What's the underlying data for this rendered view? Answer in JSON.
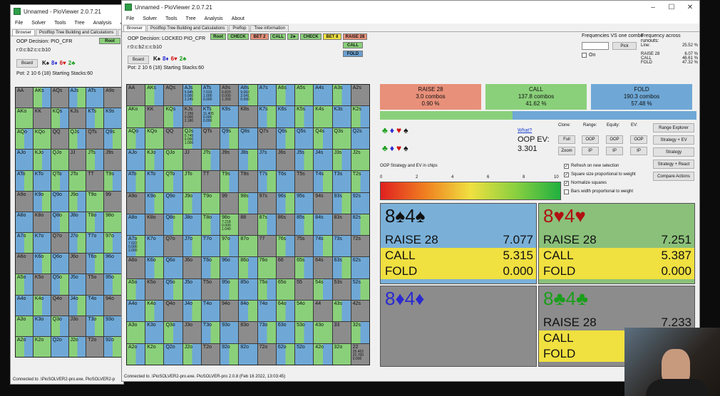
{
  "back_window": {
    "title": "Unnamed - PioViewer 2.0.7.21",
    "menu": [
      "File",
      "Solver",
      "Tools",
      "Tree",
      "Analysis",
      "Abo"
    ],
    "tabs": [
      "Browser",
      "Postflop Tree Building and Calculations",
      "Pre"
    ],
    "oop_decision": "OOP Decision:  PIO_CFR",
    "line": "r:0:c:b2:c:c:b10",
    "board_label": "Board",
    "board_cards": [
      {
        "t": "K♠",
        "c": "#111"
      },
      {
        "t": "8♦",
        "c": "#2a2ad0"
      },
      {
        "t": "6♥",
        "c": "#d01010"
      },
      {
        "t": "2♣",
        "c": "#1a9e1a"
      }
    ],
    "pot": "Pot: 2 10 6 (18) Starting Stacks:60",
    "root": "Root",
    "status": "Connected to .\\PioSOLVER2-pro.exe. PioSOLVER2-p"
  },
  "main_window": {
    "title": "Unnamed - PioViewer 2.0.7.21",
    "menu": [
      "File",
      "Solver",
      "Tools",
      "Tree",
      "Analysis",
      "About"
    ],
    "tabs": [
      "Browser",
      "Postflop Tree Building and Calculations",
      "Preflop",
      "Tree information"
    ],
    "oop_decision": "OOP Decision:  LOCKED PIO_CFR",
    "line": "r:0:c:b2:c:c:b10",
    "board_label": "Board",
    "board_cards": [
      {
        "t": "K♠",
        "c": "#111"
      },
      {
        "t": "8♦",
        "c": "#2a2ad0"
      },
      {
        "t": "6♥",
        "c": "#d01010"
      },
      {
        "t": "2♣",
        "c": "#1a9e1a"
      }
    ],
    "pot": "Pot: 2 10 6 (18) Starting Stacks:60",
    "sequence": [
      {
        "t": "Root",
        "bg": "#8ad07a"
      },
      {
        "t": "CHECK",
        "bg": "#8ad07a"
      },
      {
        "t": "BET 2",
        "bg": "#e8907a"
      },
      {
        "t": "CALL",
        "bg": "#8ad07a"
      },
      {
        "t": "2♣",
        "bg": "#8ad07a"
      },
      {
        "t": "CHECK",
        "bg": "#8ad07a"
      },
      {
        "t": "BET 8",
        "bg": "#f0e040"
      },
      {
        "t": "RAISE 28",
        "bg": "#e8907a"
      }
    ],
    "sub_actions": [
      {
        "t": "CALL",
        "bg": "#8ad07a"
      },
      {
        "t": "FOLD",
        "bg": "#6a9fd0"
      }
    ],
    "status": "Connected to .\\PioSOLVER2-pro.exe. PioSOLVER-pro 2.0.8 (Feb 16 2022, 13:03:45)",
    "freq_vs_combo": "Frequencies VS one combo",
    "pick": "Pick",
    "on_label": "On",
    "freq_runouts": "Frequency across runouts:",
    "freq_rows": [
      {
        "k": "Line:",
        "v": "25.52 %"
      },
      {
        "k": "RAISE 28",
        "v": "6.07 %"
      },
      {
        "k": "CALL",
        "v": "46.61 %"
      },
      {
        "k": "FOLD",
        "v": "47.32 %"
      }
    ],
    "summary": [
      {
        "name": "RAISE 28",
        "combos": "3.0 combos",
        "pct": "0.90 %",
        "bg": "#e8907a"
      },
      {
        "name": "CALL",
        "combos": "137.8 combos",
        "pct": "41.62 %",
        "bg": "#8ad07a"
      },
      {
        "name": "FOLD",
        "combos": "190.3 combos",
        "pct": "57.48 %",
        "bg": "#6fa8d6"
      }
    ],
    "summary_bar": {
      "green_frac": 0.42,
      "blue_frac": 0.58
    },
    "what_link": "What?",
    "oop_ev_label": "OOP EV:",
    "oop_ev_value": "3.301",
    "controls": {
      "clone": "Clone:",
      "range": "Range:",
      "equity": "Equity:",
      "ev": "EV:",
      "full": "Full",
      "zoom": "Zoom",
      "oop": "OOP",
      "ip": "IP",
      "range_explorer": "Range Explorer",
      "strategy_ev": "Strategy + EV",
      "strategy": "Strategy",
      "strategy_react": "Strategy + React",
      "compare_actions": "Compare Actions"
    },
    "checkboxes": [
      {
        "t": "Refresh on new selection",
        "checked": true
      },
      {
        "t": "Square size proportional to weight",
        "checked": true
      },
      {
        "t": "Normalize squares",
        "checked": true
      },
      {
        "t": "Bars width proportional to weight",
        "checked": false
      }
    ],
    "ev_scale_label": "OOP Strategy and EV in chips",
    "ev_ticks": [
      "0",
      "2",
      "4",
      "6",
      "8",
      "10"
    ],
    "cards": [
      {
        "title": "8♠4♠",
        "color": "#111",
        "rows": [
          {
            "a": "RAISE 28",
            "v": "7.077"
          },
          {
            "a": "CALL",
            "v": "5.315"
          },
          {
            "a": "FOLD",
            "v": "0.000"
          }
        ]
      },
      {
        "title": "8♥4♥",
        "color": "#b01010",
        "rows": [
          {
            "a": "RAISE 28",
            "v": "7.251"
          },
          {
            "a": "CALL",
            "v": "5.387"
          },
          {
            "a": "FOLD",
            "v": "0.000"
          }
        ]
      },
      {
        "title": "8♦4♦",
        "color": "#2a2ad0",
        "rows": []
      },
      {
        "title": "8♣4♣",
        "color": "#1a9e1a",
        "rows": [
          {
            "a": "RAISE 28",
            "v": "7.233"
          },
          {
            "a": "CALL",
            "v": ""
          },
          {
            "a": "FOLD",
            "v": ""
          }
        ]
      }
    ],
    "suits_row1": [
      {
        "t": "♣",
        "c": "#1a9e1a"
      },
      {
        "t": "♦",
        "c": "#2a2ad0"
      },
      {
        "t": "♥",
        "c": "#d01010"
      },
      {
        "t": "♠",
        "c": "#111"
      }
    ],
    "suits_row2": [
      {
        "t": "♣",
        "c": "#1a9e1a"
      },
      {
        "t": "♦",
        "c": "#2a2ad0"
      },
      {
        "t": "♥",
        "c": "#d01010"
      },
      {
        "t": "♠",
        "c": "#111"
      }
    ]
  },
  "ranks": [
    "A",
    "K",
    "Q",
    "J",
    "T",
    "9",
    "8",
    "7",
    "6",
    "5",
    "4",
    "3",
    "2"
  ],
  "cell_lines": {
    "AJs": [
      "5.945",
      "0.000",
      "2.245"
    ],
    "ATs": [
      "7.015",
      "1.000",
      "0.000"
    ],
    "A9s": [
      "6.820",
      "0.000",
      "1.260"
    ],
    "A8s": [
      "9.062",
      "2.041",
      "0.000"
    ],
    "KJs": [
      "7.156",
      "0.000",
      "2.180"
    ],
    "KTs": [
      "11.405",
      "0.000",
      "0.000"
    ],
    "QJs": [
      "5.745",
      "0.000",
      "1.000"
    ],
    "A7o": [
      "7.022",
      "0.000",
      "2.000"
    ],
    "98o": [
      "7.218",
      "0.000",
      "1.040"
    ],
    "22": [
      "25.452",
      "22.700",
      "0.000"
    ]
  },
  "colors": {
    "red": "#e8907a",
    "green": "#8ad07a",
    "blue": "#6fa8d6",
    "yellow": "#f0e040",
    "gray": "#8c8c8c",
    "empty": "#5a5a5a"
  }
}
